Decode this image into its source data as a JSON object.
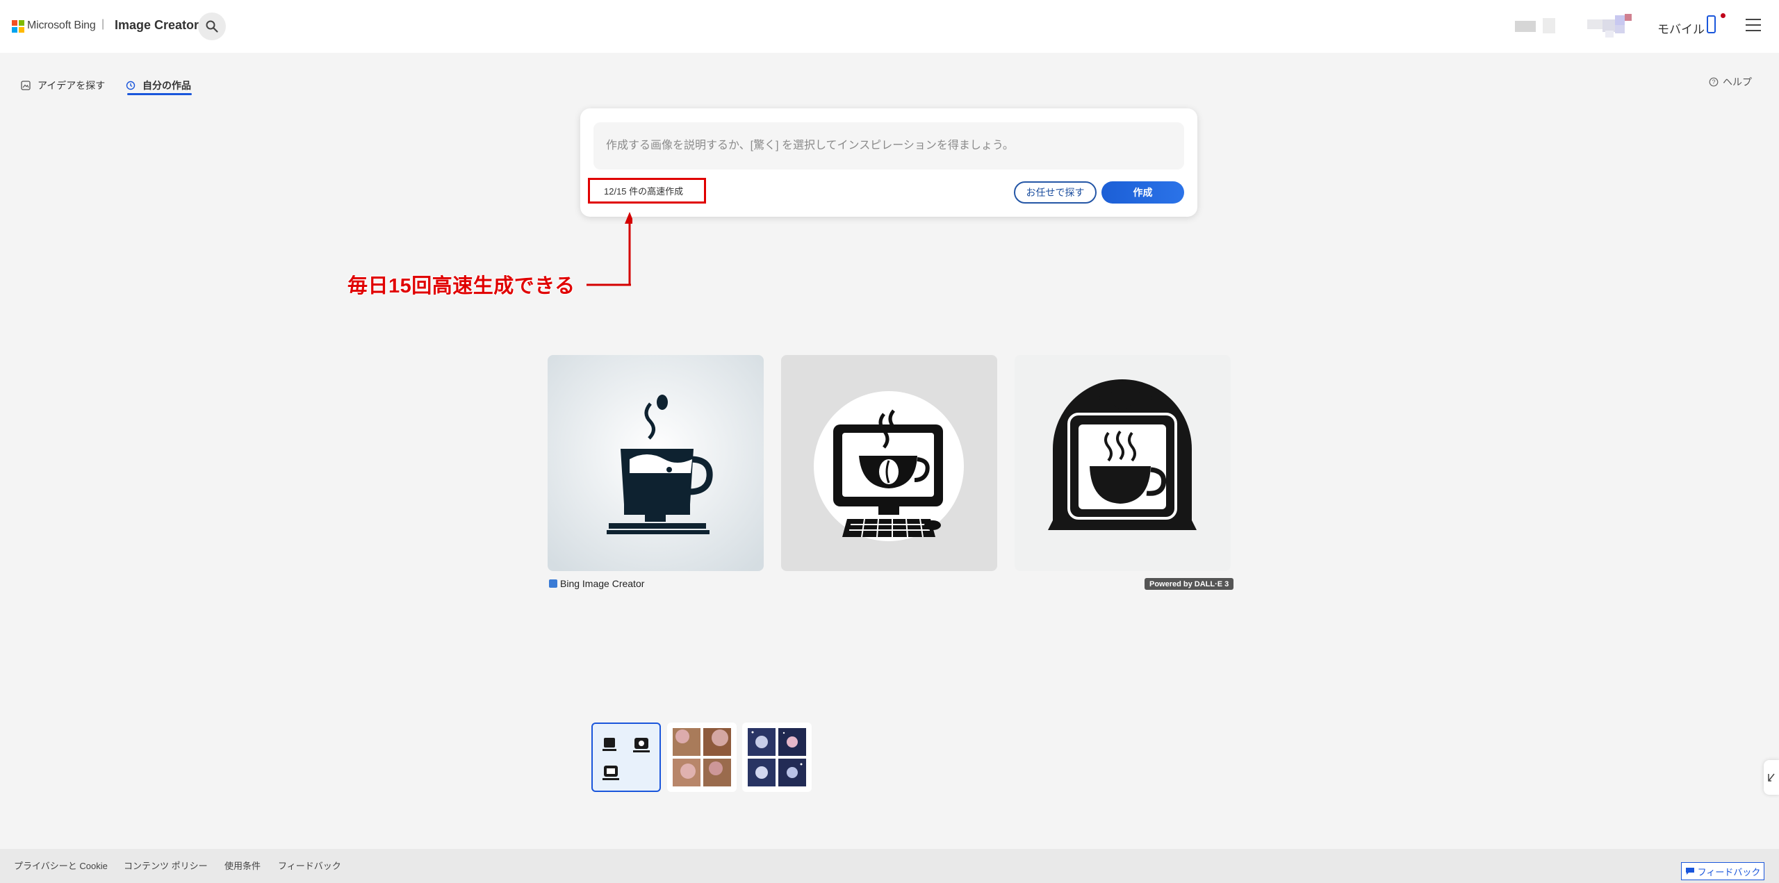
{
  "header": {
    "brand": "Microsoft Bing",
    "separator": "|",
    "app_title": "Image Creator",
    "mobile_label": "モバイル"
  },
  "tabs": [
    {
      "label": "アイデアを探す",
      "icon": "image-icon",
      "active": false
    },
    {
      "label": "自分の作品",
      "icon": "history-icon",
      "active": true
    }
  ],
  "help_label": "ヘルプ",
  "prompt": {
    "placeholder": "作成する画像を説明するか、[驚く] を選択してインスピレーションを得ましょう。",
    "value": "",
    "boost_count": "12/15 件の高速作成",
    "surprise_label": "お任せで探す",
    "create_label": "作成"
  },
  "annotation": {
    "text": "毎日15回高速生成できる",
    "color": "#e00000"
  },
  "results": {
    "caption": "Bing Image Creator",
    "powered_by": "Powered by DALL·E 3",
    "images": [
      {
        "subject": "coffee-cup-on-monitor-icon"
      },
      {
        "subject": "coffee-cup-in-monitor-circle-icon"
      },
      {
        "subject": "coffee-cup-in-laptop-icon"
      }
    ]
  },
  "history_thumbnails": [
    {
      "subject": "coffee-icons-set",
      "selected": true
    },
    {
      "subject": "cherry-blossom-scenes",
      "selected": false
    },
    {
      "subject": "space-night-scenes",
      "selected": false
    }
  ],
  "footer": {
    "links": [
      "プライバシーと Cookie",
      "コンテンツ ポリシー",
      "使用条件",
      "フィードバック"
    ],
    "feedback_button": "フィードバック"
  },
  "colors": {
    "accent": "#1a56db",
    "background": "#f4f4f4",
    "annotation_red": "#e00000"
  }
}
